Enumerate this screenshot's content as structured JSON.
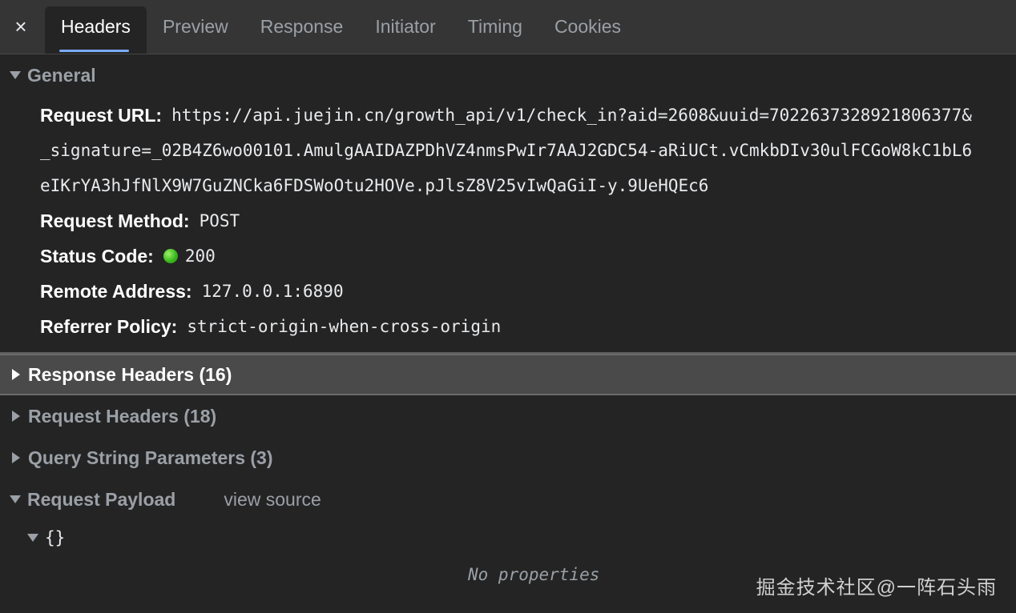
{
  "tabs": {
    "close_glyph": "×",
    "items": [
      "Headers",
      "Preview",
      "Response",
      "Initiator",
      "Timing",
      "Cookies"
    ],
    "active": "Headers"
  },
  "general": {
    "title": "General",
    "request_url_label": "Request URL:",
    "request_url_lines": [
      "https://api.juejin.cn/growth_api/v1/check_in?aid=2608&uuid=7022637328921806377&",
      "_signature=_02B4Z6wo00101.AmulgAAIDAZPDhVZ4nmsPwIr7AAJ2GDC54-aRiUCt.vCmkbDIv30ulFCGoW8kC1bL6",
      "eIKrYA3hJfNlX9W7GuZNCka6FDSWoOtu2HOVe.pJlsZ8V25vIwQaGiI-y.9UeHQEc6"
    ],
    "request_method_label": "Request Method:",
    "request_method": "POST",
    "status_code_label": "Status Code:",
    "status_code": "200",
    "status_color": "#3cba1f",
    "remote_address_label": "Remote Address:",
    "remote_address": "127.0.0.1:6890",
    "referrer_policy_label": "Referrer Policy:",
    "referrer_policy": "strict-origin-when-cross-origin"
  },
  "sections": {
    "response_headers": "Response Headers (16)",
    "request_headers": "Request Headers (18)",
    "query_params": "Query String Parameters (3)",
    "request_payload": "Request Payload",
    "view_source": "view source"
  },
  "payload": {
    "root": "{}",
    "empty": "No properties"
  },
  "watermark": "掘金技术社区@一阵石头雨"
}
